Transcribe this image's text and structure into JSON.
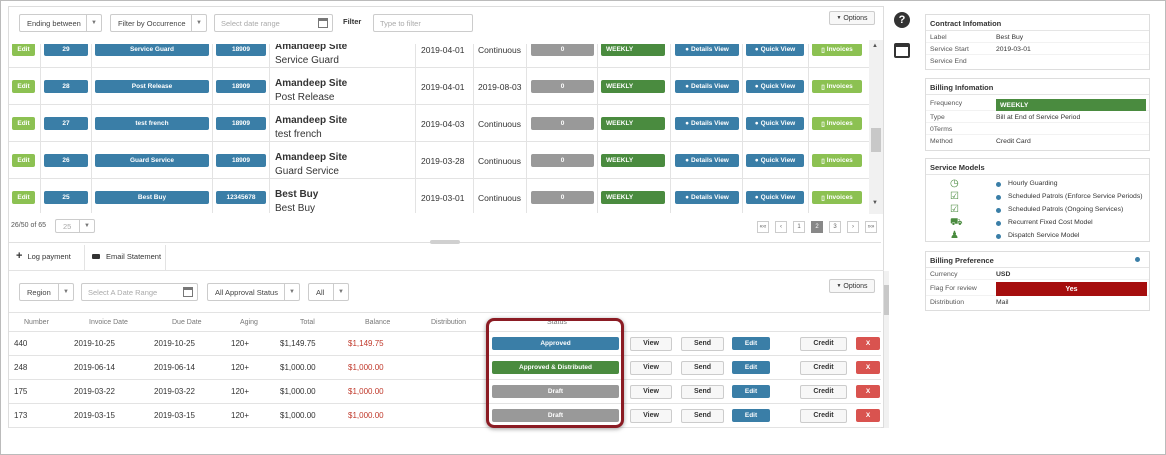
{
  "filters": {
    "ending_between": "Ending between",
    "filter_by_occurrence": "Filter by Occurrence",
    "date_range_placeholder": "Select date range",
    "filter_button": "Filter",
    "type_to_filter_placeholder": "Type to filter",
    "options": "Options"
  },
  "contracts": [
    {
      "edit": "Edit",
      "id": "29",
      "name": "Service Guard",
      "code": "18909",
      "site": "Amandeep Site",
      "sub": "Service Guard",
      "start": "2019-04-01",
      "end": "Continuous",
      "count": "0",
      "freq": "WEEKLY",
      "details": "Details View",
      "quick": "Quick View",
      "invoices": "Invoices"
    },
    {
      "edit": "Edit",
      "id": "28",
      "name": "Post Release",
      "code": "18909",
      "site": "Amandeep Site",
      "sub": "Post Release",
      "start": "2019-04-01",
      "end": "2019-08-03",
      "count": "0",
      "freq": "WEEKLY",
      "details": "Details View",
      "quick": "Quick View",
      "invoices": "Invoices"
    },
    {
      "edit": "Edit",
      "id": "27",
      "name": "test french",
      "code": "18909",
      "site": "Amandeep Site",
      "sub": "test french",
      "start": "2019-04-03",
      "end": "Continuous",
      "count": "0",
      "freq": "WEEKLY",
      "details": "Details View",
      "quick": "Quick View",
      "invoices": "Invoices"
    },
    {
      "edit": "Edit",
      "id": "26",
      "name": "Guard Service",
      "code": "18909",
      "site": "Amandeep Site",
      "sub": "Guard Service",
      "start": "2019-03-28",
      "end": "Continuous",
      "count": "0",
      "freq": "WEEKLY",
      "details": "Details View",
      "quick": "Quick View",
      "invoices": "Invoices"
    },
    {
      "edit": "Edit",
      "id": "25",
      "name": "Best Buy",
      "code": "12345678",
      "site": "Best Buy",
      "sub": "Best Buy",
      "start": "2019-03-01",
      "end": "Continuous",
      "count": "0",
      "freq": "WEEKLY",
      "details": "Details View",
      "quick": "Quick View",
      "invoices": "Invoices"
    }
  ],
  "pagination": {
    "summary": "26/50 of 65",
    "per_page": "25",
    "pages": [
      "««",
      "‹",
      "1",
      "2",
      "3",
      "›",
      "»»"
    ],
    "active_page": "2"
  },
  "lower_tabs": {
    "log_payment": "Log payment",
    "email_statement": "Email Statement"
  },
  "lower_filters": {
    "region": "Region",
    "date_range_placeholder": "Select A Date Range",
    "approval_status": "All Approval Status",
    "all": "All",
    "options": "Options"
  },
  "invoice_headers": {
    "number": "Number",
    "invoice_date": "Invoice Date",
    "due_date": "Due Date",
    "aging": "Aging",
    "total": "Total",
    "balance": "Balance",
    "distribution": "Distribution",
    "status": "Status"
  },
  "invoices": [
    {
      "number": "440",
      "invoice_date": "2019-10-25",
      "due_date": "2019-10-25",
      "aging": "120+",
      "total": "$1,149.75",
      "balance": "$1,149.75",
      "status": "Approved",
      "view": "View",
      "send": "Send",
      "edit": "Edit",
      "credit": "Credit",
      "delete": "X"
    },
    {
      "number": "248",
      "invoice_date": "2019-06-14",
      "due_date": "2019-06-14",
      "aging": "120+",
      "total": "$1,000.00",
      "balance": "$1,000.00",
      "status": "Approved & Distributed",
      "view": "View",
      "send": "Send",
      "edit": "Edit",
      "credit": "Credit",
      "delete": "X"
    },
    {
      "number": "175",
      "invoice_date": "2019-03-22",
      "due_date": "2019-03-22",
      "aging": "120+",
      "total": "$1,000.00",
      "balance": "$1,000.00",
      "status": "Draft",
      "view": "View",
      "send": "Send",
      "edit": "Edit",
      "credit": "Credit",
      "delete": "X"
    },
    {
      "number": "173",
      "invoice_date": "2019-03-15",
      "due_date": "2019-03-15",
      "aging": "120+",
      "total": "$1,000.00",
      "balance": "$1,000.00",
      "status": "Draft",
      "view": "View",
      "send": "Send",
      "edit": "Edit",
      "credit": "Credit",
      "delete": "X"
    }
  ],
  "contract_info": {
    "title": "Contract Infomation",
    "label_key": "Label",
    "label_val": "Best Buy",
    "start_key": "Service Start",
    "start_val": "2019-03-01",
    "end_key": "Service End"
  },
  "billing_info": {
    "title": "Billing Infomation",
    "frequency_key": "Frequency",
    "frequency_val": "WEEKLY",
    "type_key": "Type",
    "type_val": "Bill at End of Service Period",
    "terms_key": "0Terms",
    "method_key": "Method",
    "method_val": "Credit Card"
  },
  "service_models": {
    "title": "Service Models",
    "items": [
      "Hourly Guarding",
      "Scheduled Patrols (Enforce Service Periods)",
      "Scheduled Patrols (Ongoing Services)",
      "Recurrent Fixed Cost Model",
      "Dispatch Service Model"
    ]
  },
  "billing_pref": {
    "title": "Billing Preference",
    "currency_key": "Currency",
    "currency_val": "USD",
    "flag_key": "Flag For review",
    "flag_val": "Yes",
    "distribution_key": "Distribution",
    "distribution_val": "Mail"
  },
  "colors": {
    "accent_blue": "#3a7ea7",
    "status_green": "#4a8b3f",
    "edit_green": "#8cc152",
    "danger": "#a50e0e",
    "highlight_border": "#8b1c24"
  }
}
